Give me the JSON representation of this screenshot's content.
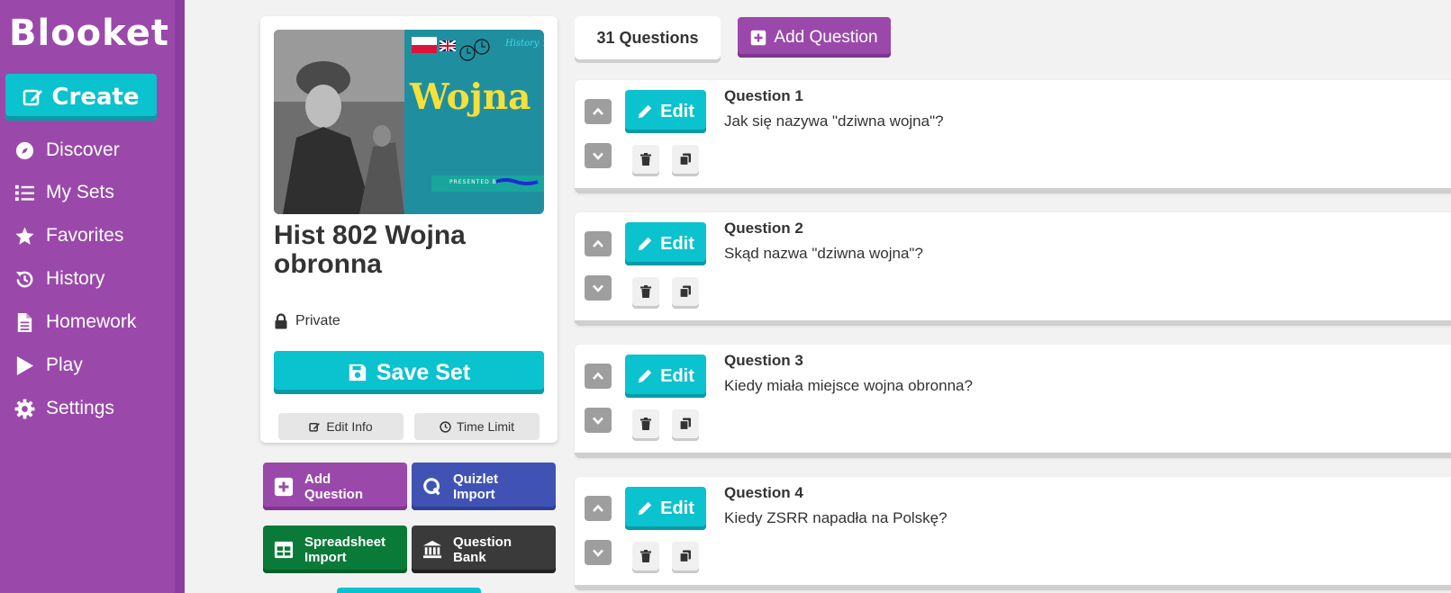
{
  "app": {
    "name": "Blooket"
  },
  "sidebar": {
    "create_label": "Create",
    "items": [
      {
        "label": "Discover",
        "icon": "compass-icon"
      },
      {
        "label": "My Sets",
        "icon": "list-icon"
      },
      {
        "label": "Favorites",
        "icon": "star-icon"
      },
      {
        "label": "History",
        "icon": "history-icon"
      },
      {
        "label": "Homework",
        "icon": "document-icon"
      },
      {
        "label": "Play",
        "icon": "play-icon"
      },
      {
        "label": "Settings",
        "icon": "gear-icon"
      }
    ]
  },
  "set": {
    "cover": {
      "title": "Wojna obronna",
      "history_label": "History 1",
      "banner": "PRESENTED BY"
    },
    "title": "Hist 802 Wojna obronna",
    "visibility": "Private",
    "save_label": "Save Set",
    "edit_info_label": "Edit Info",
    "time_limit_label": "Time Limit"
  },
  "tools": {
    "add_question": "Add Question",
    "quizlet_import": "Quizlet Import",
    "spreadsheet_import": "Spreadsheet Import",
    "question_bank": "Question Bank"
  },
  "header": {
    "question_count": "31 Questions",
    "add_question_label": "Add Question"
  },
  "questions": [
    {
      "label": "Question 1",
      "text": "Jak się nazywa \"dziwna wojna\"?",
      "edit_label": "Edit"
    },
    {
      "label": "Question 2",
      "text": "Skąd nazwa \"dziwna wojna\"?",
      "edit_label": "Edit"
    },
    {
      "label": "Question 3",
      "text": "Kiedy miała miejsce wojna obronna?",
      "edit_label": "Edit"
    },
    {
      "label": "Question 4",
      "text": "Kiedy ZSRR napadła na Polskę?",
      "edit_label": "Edit"
    }
  ],
  "colors": {
    "sidebar": "#9a49aa",
    "teal": "#0bc2cf",
    "purple": "#9a49aa",
    "blue": "#4053b5",
    "green": "#0a7a38",
    "dark": "#3a3a3a"
  }
}
